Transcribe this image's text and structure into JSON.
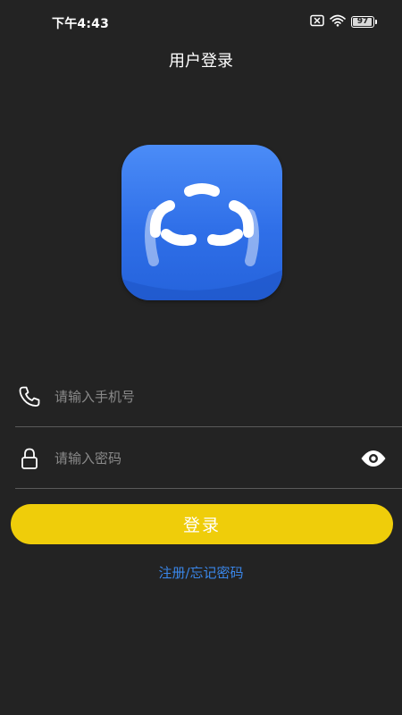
{
  "status_bar": {
    "time": "下午4:43",
    "battery_level": "97",
    "icons": [
      "sim-error-icon",
      "wifi-icon",
      "battery-icon"
    ]
  },
  "header": {
    "title": "用户登录"
  },
  "logo": {
    "icon": "app-logo-icon",
    "background": "#2f6fe8"
  },
  "form": {
    "phone": {
      "icon": "phone-icon",
      "placeholder": "请输入手机号",
      "value": ""
    },
    "password": {
      "icon": "lock-icon",
      "placeholder": "请输入密码",
      "value": "",
      "toggle_icon": "eye-icon"
    },
    "login_label": "登录",
    "register_link": "注册/忘记密码"
  },
  "colors": {
    "background": "#232323",
    "accent": "#efcd0a",
    "link": "#3a86e8"
  }
}
